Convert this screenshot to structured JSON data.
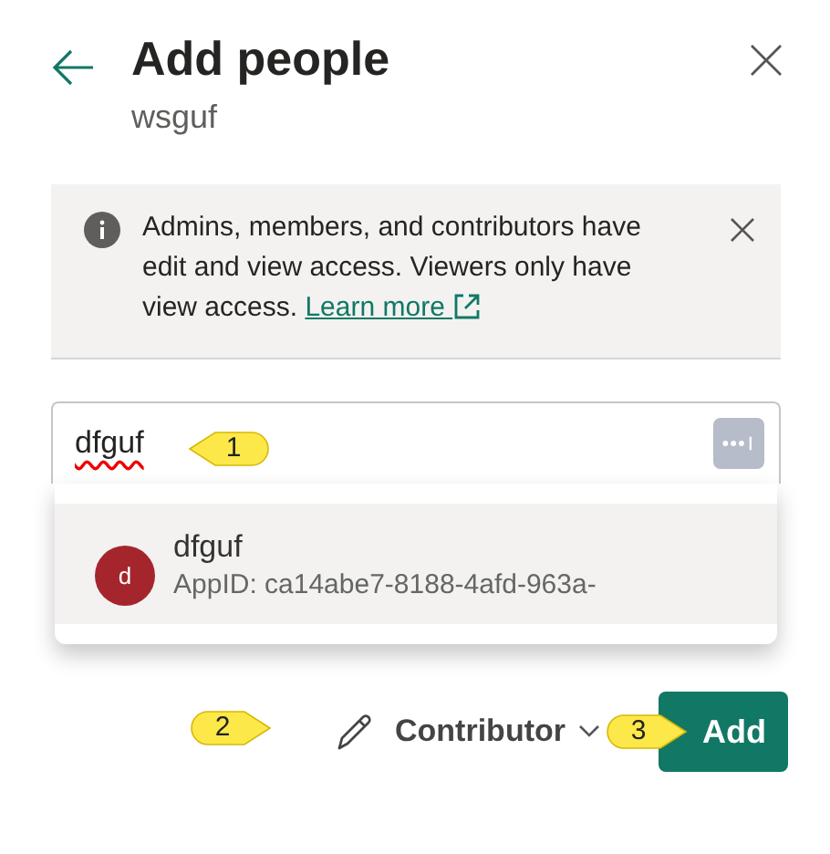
{
  "header": {
    "title": "Add people",
    "subtitle": "wsguf"
  },
  "info": {
    "text": "Admins, members, and contributors have edit and view access. Viewers only have view access.",
    "link": "Learn more"
  },
  "search": {
    "value": "dfguf"
  },
  "suggestions": [
    {
      "initial": "d",
      "name": "dfguf",
      "detail": "AppID: ca14abe7-8188-4afd-963a-",
      "color": "#a4262c",
      "selected": true
    }
  ],
  "role": {
    "label": "Contributor"
  },
  "add_button": "Add",
  "callouts": [
    {
      "number": "1",
      "kind": "left"
    },
    {
      "number": "2",
      "kind": "right"
    },
    {
      "number": "3",
      "kind": "right"
    }
  ]
}
